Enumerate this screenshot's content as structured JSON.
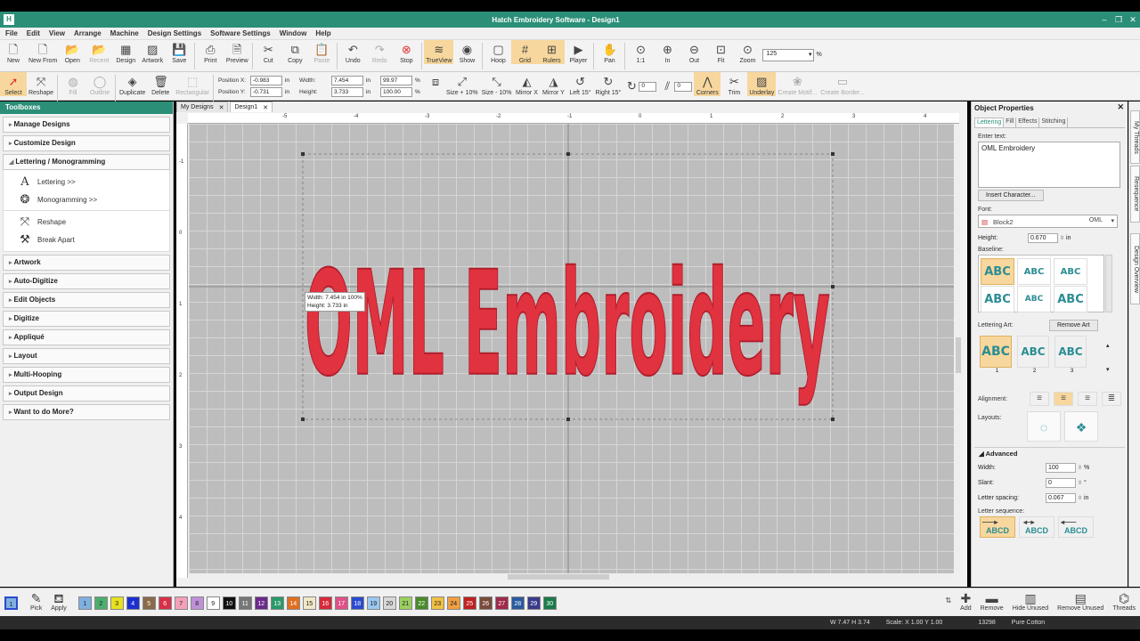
{
  "window": {
    "title": "Hatch Embroidery Software - Design1"
  },
  "menu": [
    "File",
    "Edit",
    "View",
    "Arrange",
    "Machine",
    "Design Settings",
    "Software Settings",
    "Window",
    "Help"
  ],
  "toolbar1": {
    "buttons": [
      "New",
      "New From",
      "Open",
      "Recent",
      "Design",
      "Artwork",
      "Save",
      "Print",
      "Preview",
      "Cut",
      "Copy",
      "Paste",
      "Undo",
      "Redo",
      "Stop",
      "TrueView",
      "Show",
      "Hoop",
      "Grid",
      "Rulers",
      "Player",
      "Pan",
      "1:1",
      "In",
      "Out",
      "Fit",
      "Zoom"
    ],
    "zoom_value": "125",
    "zoom_unit": "%"
  },
  "toolbar2": {
    "select": "Select",
    "reshape": "Reshape",
    "fill": "Fill",
    "outline": "Outline",
    "duplicate": "Duplicate",
    "delete": "Delete",
    "rectangular": "Rectangular",
    "pos_x_label": "Position X:",
    "pos_x": "-0.983",
    "pos_y_label": "Position Y:",
    "pos_y": "-0.731",
    "width_label": "Width:",
    "width": "7.454",
    "height_label": "Height:",
    "height": "3.733",
    "unit_in": "in",
    "pct_w": "99.97",
    "pct_h": "100.00",
    "pct": "%",
    "size_plus": "Size + 10%",
    "size_minus": "Size - 10%",
    "mirror_x": "Mirror X",
    "mirror_y": "Mirror Y",
    "left15": "Left 15°",
    "right15": "Right 15°",
    "rotate_val": "0",
    "slant_val": "0",
    "corners": "Corners",
    "trim": "Trim",
    "underlay": "Underlay",
    "create_motif": "Create Motif...",
    "create_border": "Create Border..."
  },
  "toolboxes": {
    "title": "Toolboxes",
    "sections_top": [
      "Manage Designs",
      "Customize Design"
    ],
    "open_section": "Lettering / Monogramming",
    "sub_items": [
      "Lettering >>",
      "Monogramming >>",
      "Reshape",
      "Break Apart"
    ],
    "sections_bottom": [
      "Artwork",
      "Auto-Digitize",
      "Edit Objects",
      "Digitize",
      "Appliqué",
      "Layout",
      "Multi-Hooping",
      "Output Design",
      "Want to do More?"
    ]
  },
  "tabs": [
    "My Designs",
    "Design1"
  ],
  "ruler_h": [
    "-5",
    "-4",
    "-3",
    "-2",
    "-1",
    "0",
    "1",
    "2",
    "3",
    "4"
  ],
  "ruler_v": [
    "-1",
    "0",
    "1",
    "2",
    "3",
    "4"
  ],
  "design_text": "OML Embroidery",
  "tooltip": {
    "line1": "Width: 7.454 in 100%",
    "line2": "Height: 3.733 in"
  },
  "props": {
    "title": "Object Properties",
    "tabs": [
      "Lettering",
      "Fill",
      "Effects",
      "Stitching"
    ],
    "enter_text_label": "Enter text:",
    "text_value": "OML Embroidery",
    "insert_char": "Insert Character...",
    "font_label": "Font:",
    "font_value": "Block2",
    "font_sample": "OML",
    "height_label": "Height:",
    "height_value": "0.670",
    "height_unit": "in",
    "baseline_label": "Baseline:",
    "lettering_art_label": "Lettering Art:",
    "remove_art": "Remove Art",
    "art_numbers": [
      "1",
      "2",
      "3"
    ],
    "abc": "ABC",
    "alignment_label": "Alignment:",
    "layouts_label": "Layouts:",
    "advanced_label": "Advanced",
    "adv_width_label": "Width:",
    "adv_width_value": "100",
    "adv_width_unit": "%",
    "slant_label": "Slant:",
    "slant_value": "0",
    "slant_unit": "°",
    "spacing_label": "Letter spacing:",
    "spacing_value": "0.067",
    "spacing_unit": "in",
    "sequence_label": "Letter sequence:",
    "abcd": "ABCD"
  },
  "side_tabs": [
    "My Threads",
    "Resequence",
    "Design Overview"
  ],
  "palette": {
    "swatches": [
      {
        "n": "1",
        "c": "#7fb0e0"
      },
      {
        "n": "2",
        "c": "#4fae6e"
      },
      {
        "n": "3",
        "c": "#e6e020"
      },
      {
        "n": "4",
        "c": "#1a2fd0"
      },
      {
        "n": "5",
        "c": "#8a6a4a"
      },
      {
        "n": "6",
        "c": "#d8304a"
      },
      {
        "n": "7",
        "c": "#f4a0b8"
      },
      {
        "n": "8",
        "c": "#c090d8"
      },
      {
        "n": "9",
        "c": "#ffffff"
      },
      {
        "n": "10",
        "c": "#111111"
      },
      {
        "n": "11",
        "c": "#777777"
      },
      {
        "n": "12",
        "c": "#6a2a8a"
      },
      {
        "n": "13",
        "c": "#2a9a6a"
      },
      {
        "n": "14",
        "c": "#e07020"
      },
      {
        "n": "15",
        "c": "#f0e8c8"
      },
      {
        "n": "16",
        "c": "#d82a3a"
      },
      {
        "n": "17",
        "c": "#e0508a"
      },
      {
        "n": "18",
        "c": "#2a4ad0"
      },
      {
        "n": "19",
        "c": "#9ac8f0"
      },
      {
        "n": "20",
        "c": "#d8d8d8"
      },
      {
        "n": "21",
        "c": "#9ad060"
      },
      {
        "n": "22",
        "c": "#4a8a2a"
      },
      {
        "n": "23",
        "c": "#f0c040"
      },
      {
        "n": "24",
        "c": "#f0a040"
      },
      {
        "n": "25",
        "c": "#c02020"
      },
      {
        "n": "26",
        "c": "#7a4a3a"
      },
      {
        "n": "27",
        "c": "#a02a4a"
      },
      {
        "n": "28",
        "c": "#2a5aa0"
      },
      {
        "n": "29",
        "c": "#3a3a8a"
      },
      {
        "n": "30",
        "c": "#1a7a4a"
      }
    ],
    "pick": "Pick",
    "apply": "Apply",
    "first": "1"
  },
  "bottom_tools": [
    "Add",
    "Remove",
    "Hide Unused",
    "Remove Unused",
    "Threads"
  ],
  "status": {
    "wh": "W 7.47 H 3.74",
    "scale": "Scale: X 1.00 Y 1.00",
    "stitches": "13298",
    "fabric": "Pure Cotton"
  },
  "colors": {
    "accent": "#2b8f78",
    "thread": "#e0323f"
  }
}
